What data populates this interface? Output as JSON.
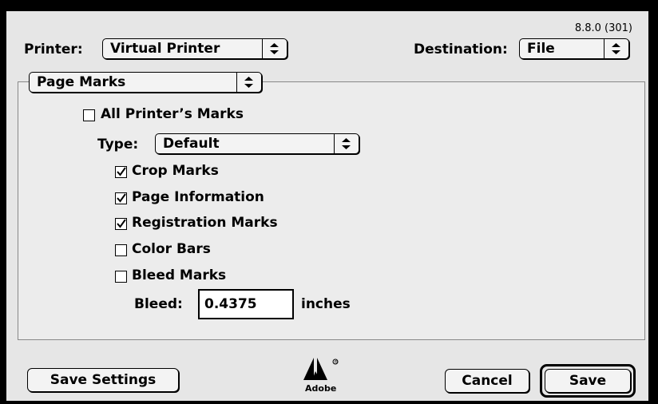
{
  "version": "8.8.0 (301)",
  "printer": {
    "label": "Printer:",
    "value": "Virtual Printer"
  },
  "destination": {
    "label": "Destination:",
    "value": "File"
  },
  "section_popup": {
    "value": "Page Marks"
  },
  "all_marks": {
    "label": "All Printer’s Marks",
    "checked": false
  },
  "type": {
    "label": "Type:",
    "value": "Default"
  },
  "marks": [
    {
      "label": "Crop Marks",
      "checked": true
    },
    {
      "label": "Page Information",
      "checked": true
    },
    {
      "label": "Registration Marks",
      "checked": true
    },
    {
      "label": "Color Bars",
      "checked": false
    },
    {
      "label": "Bleed Marks",
      "checked": false
    }
  ],
  "bleed": {
    "label": "Bleed:",
    "value": "0.4375",
    "unit": "inches"
  },
  "buttons": {
    "save_settings": "Save Settings",
    "cancel": "Cancel",
    "save": "Save"
  },
  "logo": {
    "text": "Adobe",
    "mark": "®"
  }
}
